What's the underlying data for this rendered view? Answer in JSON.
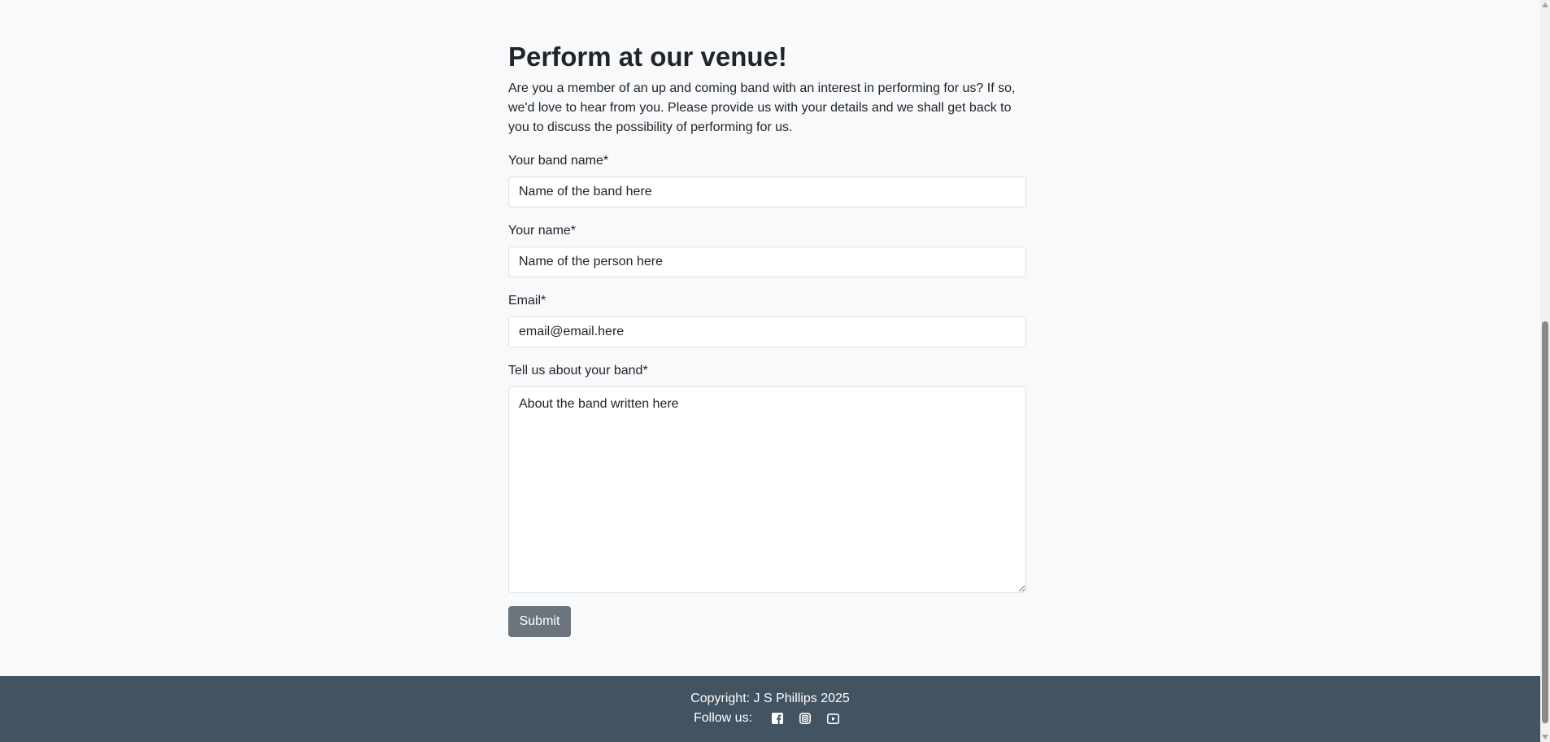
{
  "page": {
    "title": "Perform at our venue!",
    "intro": "Are you a member of an up and coming band with an interest in performing for us? If so, we'd love to hear from you. Please provide us with your details and we shall get back to you to discuss the possibility of performing for us."
  },
  "form": {
    "band_name": {
      "label": "Your band name*",
      "placeholder": "Name of the band here"
    },
    "your_name": {
      "label": "Your name*",
      "placeholder": "Name of the person here"
    },
    "email": {
      "label": "Email*",
      "placeholder": "email@email.here"
    },
    "about": {
      "label": "Tell us about your band*",
      "placeholder": "About the band written here"
    },
    "submit_label": "Submit"
  },
  "footer": {
    "copyright": "Copyright: J S Phillips 2025",
    "follow_label": "Follow us:",
    "social": [
      {
        "icon": "facebook-icon"
      },
      {
        "icon": "instagram-icon"
      },
      {
        "icon": "youtube-icon"
      }
    ]
  },
  "colors": {
    "background": "#f8f9fa",
    "footer": "#425361",
    "submit": "#6c757d"
  }
}
